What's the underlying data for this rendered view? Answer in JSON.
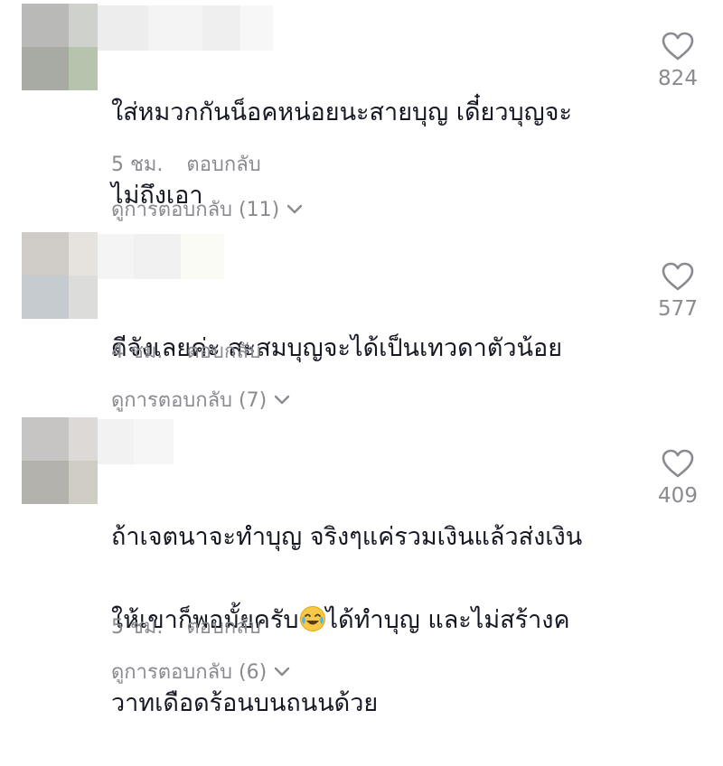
{
  "comments": [
    {
      "text_line1": "ใส่หมวกกันน็อคหน่อยนะสายบุญ เดี๋ยวบุญจะ",
      "text_line2": "ไม่ถึงเอา",
      "time": "5 ชม.",
      "reply_label": "ตอบกลับ",
      "view_replies": "ดูการตอบกลับ (11)",
      "likes": "824"
    },
    {
      "text_line1": "ดีจังเลยค่ะ สะสมบุญจะได้เป็นเทวดาตัวน้อย",
      "time": "4 ชม.",
      "reply_label": "ตอบกลับ",
      "view_replies": "ดูการตอบกลับ (7)",
      "likes": "577"
    },
    {
      "text_line1": "ถ้าเจตนาจะทำบุญ จริงๆแค่รวมเงินแล้วส่งเงิน",
      "text_line2a": "ให้เขาก็พอมั้ยครับ",
      "text_line2b": "ได้ทำบุญ และไม่สร้างค",
      "text_line3": "วาทเดือดร้อนบนถนนด้วย",
      "time": "5 ชม.",
      "reply_label": "ตอบกลับ",
      "view_replies": "ดูการตอบกลับ (6)",
      "likes": "409"
    }
  ],
  "icons": {
    "like": "heart-outline-icon",
    "expand": "chevron-down-icon",
    "emoji": "face-with-tears-of-joy-emoji"
  },
  "colors": {
    "text": "#161823",
    "secondary": "#8a8b91"
  }
}
